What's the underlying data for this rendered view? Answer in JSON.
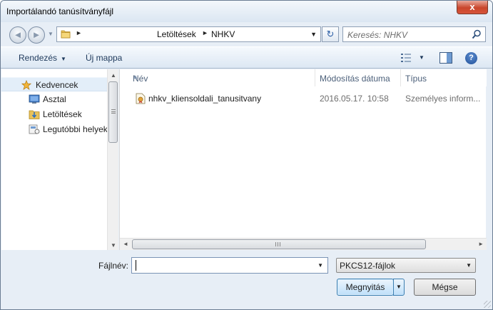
{
  "window": {
    "title": "Importálandó tanúsítványfájl",
    "close_glyph": "x"
  },
  "nav": {
    "back_glyph": "◄",
    "forward_glyph": "►",
    "recent_glyph": "▼"
  },
  "address": {
    "separator": "►",
    "crumbs": [
      "Letöltések",
      "NHKV"
    ],
    "dropdown_glyph": "▼"
  },
  "refresh_glyph": "↻",
  "search": {
    "placeholder": "Keresés: NHKV"
  },
  "commands": {
    "organize": "Rendezés",
    "new_folder": "Új mappa",
    "dropdown_glyph": "▼",
    "help_glyph": "?"
  },
  "navpane": {
    "favorites": "Kedvencek",
    "items": [
      "Asztal",
      "Letöltések",
      "Legutóbbi helyek"
    ],
    "scroll_up": "▲",
    "scroll_down": "▼"
  },
  "filelist": {
    "columns": {
      "name": "Név",
      "date": "Módosítás dátuma",
      "type": "Típus"
    },
    "sort_glyph": "▲",
    "files": [
      {
        "name": "nhkv_kliensoldali_tanusitvany",
        "date": "2016.05.17. 10:58",
        "type": "Személyes inform..."
      }
    ],
    "scroll_left": "◄",
    "scroll_right": "►"
  },
  "bottom": {
    "filename_label": "Fájlnév:",
    "filename_value": "",
    "filetype_value": "PKCS12-fájlok",
    "open_label": "Megnyitás",
    "cancel_label": "Mégse",
    "dropdown_glyph": "▼"
  },
  "colors": {
    "accent": "#3c7fb1",
    "chrome": "#e7eef6",
    "help": "#1f4f98"
  },
  "icons": {
    "favorites": "star-icon",
    "desktop": "desktop-icon",
    "downloads": "downloads-folder-icon",
    "recent": "recent-places-icon",
    "file": "certificate-file-icon",
    "search": "search-icon",
    "views": "views-icon",
    "preview_pane": "preview-pane-icon",
    "help": "help-icon"
  }
}
